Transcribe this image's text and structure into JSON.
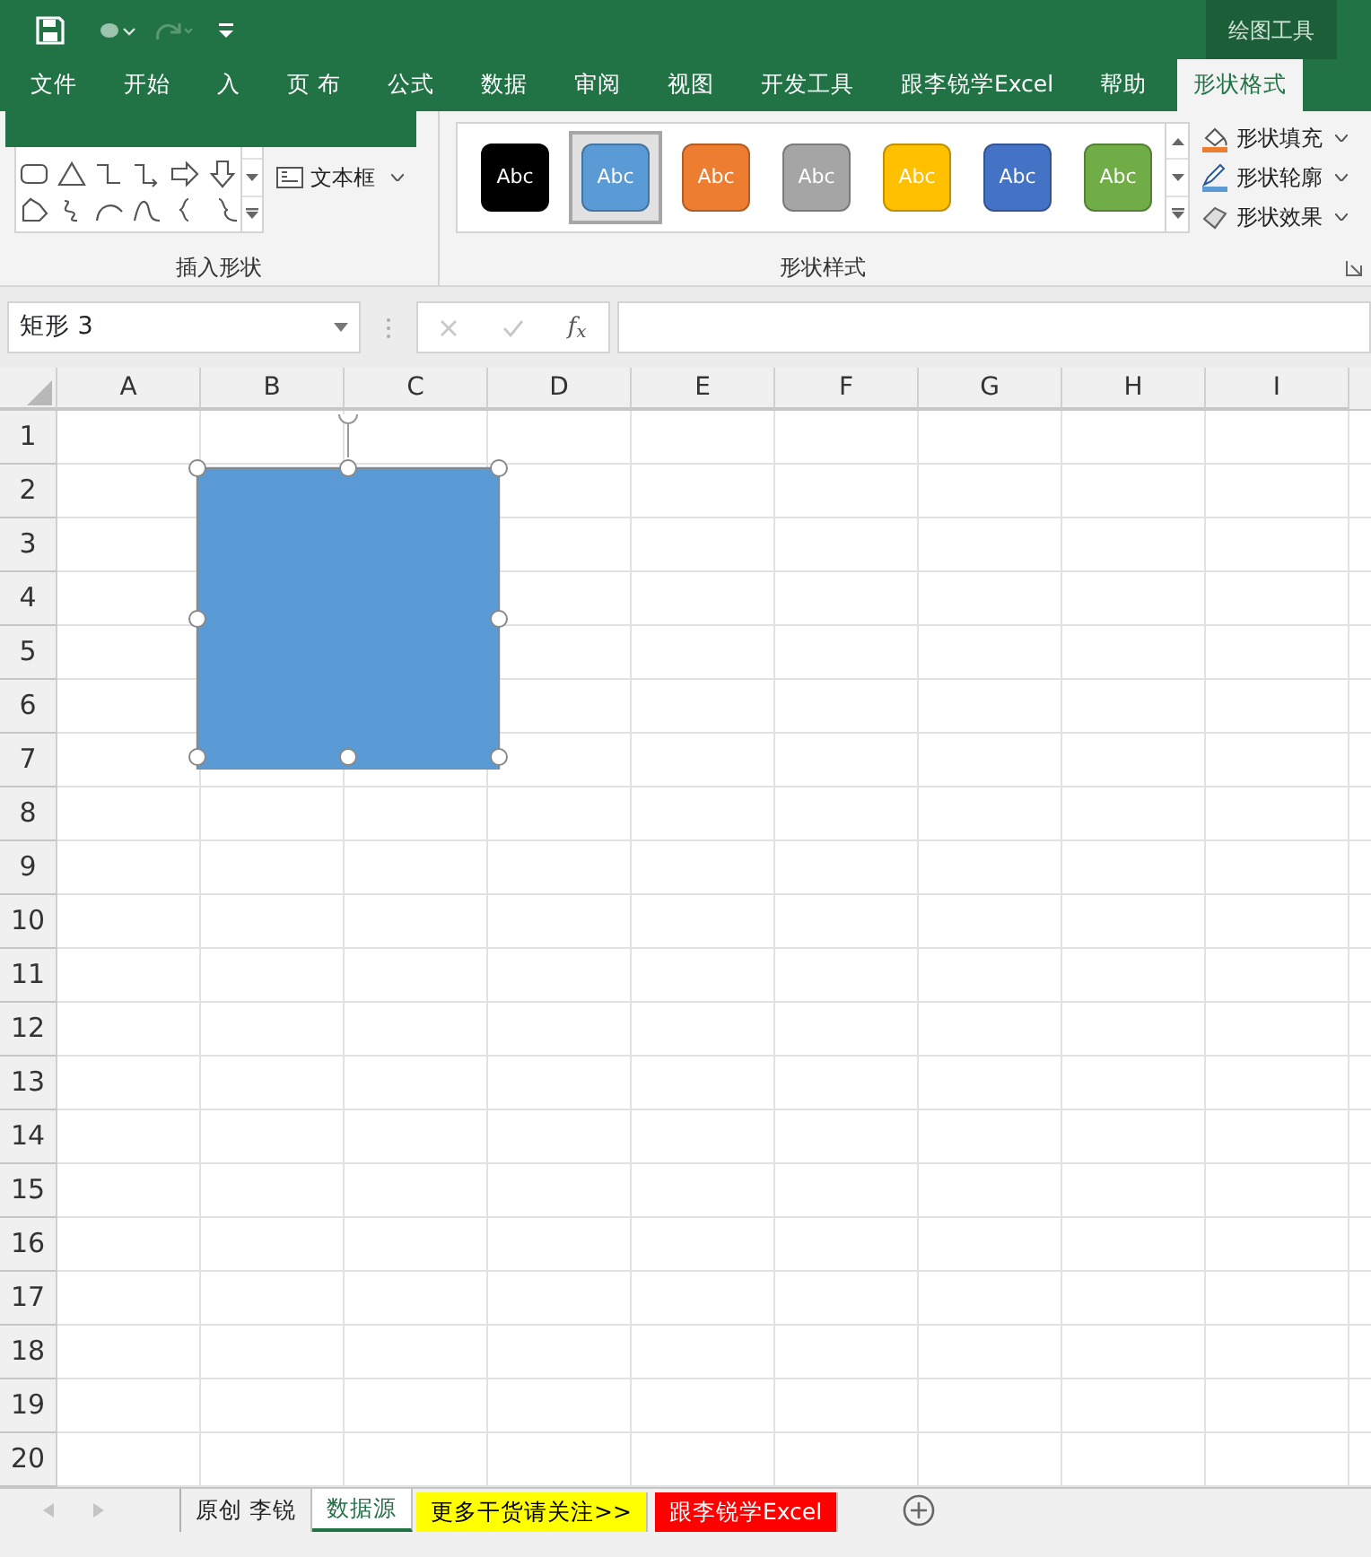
{
  "contextual_tab_group": "绘图工具",
  "ribbon_tabs": [
    {
      "label": "文件",
      "selected": false
    },
    {
      "label": "开始",
      "selected": false
    },
    {
      "label": "入",
      "selected": false
    },
    {
      "label": "页 布",
      "selected": false
    },
    {
      "label": "公式",
      "selected": false
    },
    {
      "label": "数据",
      "selected": false
    },
    {
      "label": "审阅",
      "selected": false
    },
    {
      "label": "视图",
      "selected": false
    },
    {
      "label": "开发工具",
      "selected": false
    },
    {
      "label": "跟李锐学Excel",
      "selected": false
    },
    {
      "label": "帮助",
      "selected": false
    },
    {
      "label": "形状格式",
      "selected": true
    }
  ],
  "insert_shapes_group": {
    "label": "插入形状",
    "text_box": "文本框"
  },
  "shape_styles_group": {
    "label": "形状样式",
    "presets": [
      {
        "label": "Abc",
        "color": "#000000",
        "selected": false
      },
      {
        "label": "Abc",
        "color": "#5b9bd5",
        "selected": true
      },
      {
        "label": "Abc",
        "color": "#ed7d31",
        "selected": false
      },
      {
        "label": "Abc",
        "color": "#a5a5a5",
        "selected": false
      },
      {
        "label": "Abc",
        "color": "#ffc000",
        "selected": false
      },
      {
        "label": "Abc",
        "color": "#4472c4",
        "selected": false
      },
      {
        "label": "Abc",
        "color": "#70ad47",
        "selected": false
      }
    ],
    "commands": [
      "形状填充",
      "形状轮廓",
      "形状效果"
    ]
  },
  "name_box": "矩形 3",
  "function_label": "f$_{x}$",
  "columns": [
    "A",
    "B",
    "C",
    "D",
    "E",
    "F",
    "G",
    "H",
    "I"
  ],
  "rows": [
    "1",
    "2",
    "3",
    "4",
    "5",
    "6",
    "7",
    "8",
    "9",
    "10",
    "11",
    "12",
    "13",
    "14",
    "15",
    "16",
    "17",
    "18",
    "19",
    "20"
  ],
  "shape": {
    "kind": "rectangle",
    "color": "#5b9bd5",
    "selected": true
  },
  "sheet_tabs": [
    {
      "label": "原创 李锐",
      "selected": false
    },
    {
      "label": "数据源",
      "selected": true
    },
    {
      "label": "更多干货请关注>>",
      "selected": false,
      "color": "#ffff00"
    },
    {
      "label": "跟李锐学Excel",
      "selected": false,
      "color": "#ff0000"
    }
  ]
}
